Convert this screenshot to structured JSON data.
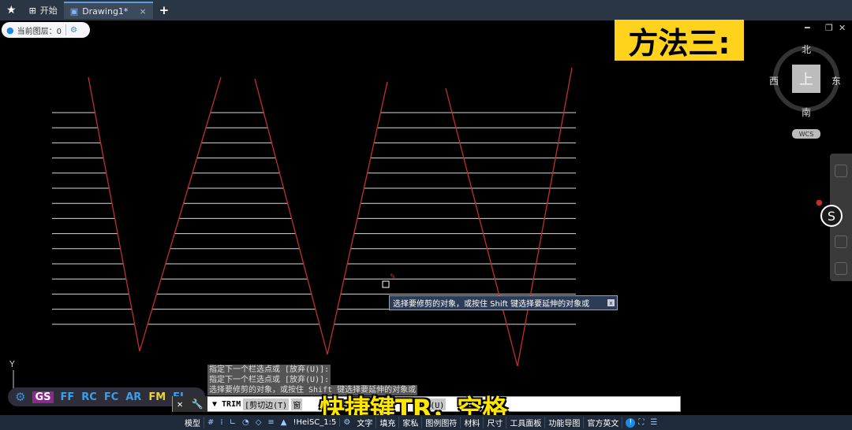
{
  "tabs": [
    {
      "label": "开始"
    },
    {
      "label": "Drawing1*",
      "close": "×"
    }
  ],
  "new_tab": "+",
  "layer": {
    "label": "当前图层：0"
  },
  "title_box": "方法三:",
  "window_controls": {
    "min": "━",
    "restore": "❐",
    "close": "✕"
  },
  "viewcube": {
    "north": "北",
    "south": "南",
    "west": "西",
    "east": "东",
    "face": "上",
    "wcs": "WCS"
  },
  "tooltip": {
    "text": "选择要修剪的对象，或按住 Shift 键选择要延伸的对象或",
    "close": "x"
  },
  "command_history": [
    "指定下一个栏选点或 [放弃(U)]:",
    "指定下一个栏选点或 [放弃(U)]:",
    "选择要修剪的对象，或按住 Shift 键选择要延伸的对象或"
  ],
  "command_line": {
    "command": "TRIM",
    "opt1": "[剪切边(T)",
    "opt2": "窗",
    "opt3": "放弃(U)"
  },
  "ucs": {
    "y": "Y"
  },
  "ext_toolbar": [
    "GS",
    "FF",
    "RC",
    "FC",
    "AR",
    "FM",
    "FI"
  ],
  "subtitle": "快捷键TR，空格",
  "statusbar": {
    "model": "模型",
    "annotation": "!HeiSC_1:5",
    "items": [
      "文字",
      "填充",
      "家私",
      "图例图符",
      "材料",
      "尺寸",
      "工具面板",
      "功能导图",
      "官方英文"
    ]
  },
  "colors": {
    "tab_bar": "#2b3645",
    "line_red": "#c0302a",
    "line_white": "#d8d8d8",
    "title_bg": "#ffd21c",
    "subtitle": "#ffe800"
  }
}
